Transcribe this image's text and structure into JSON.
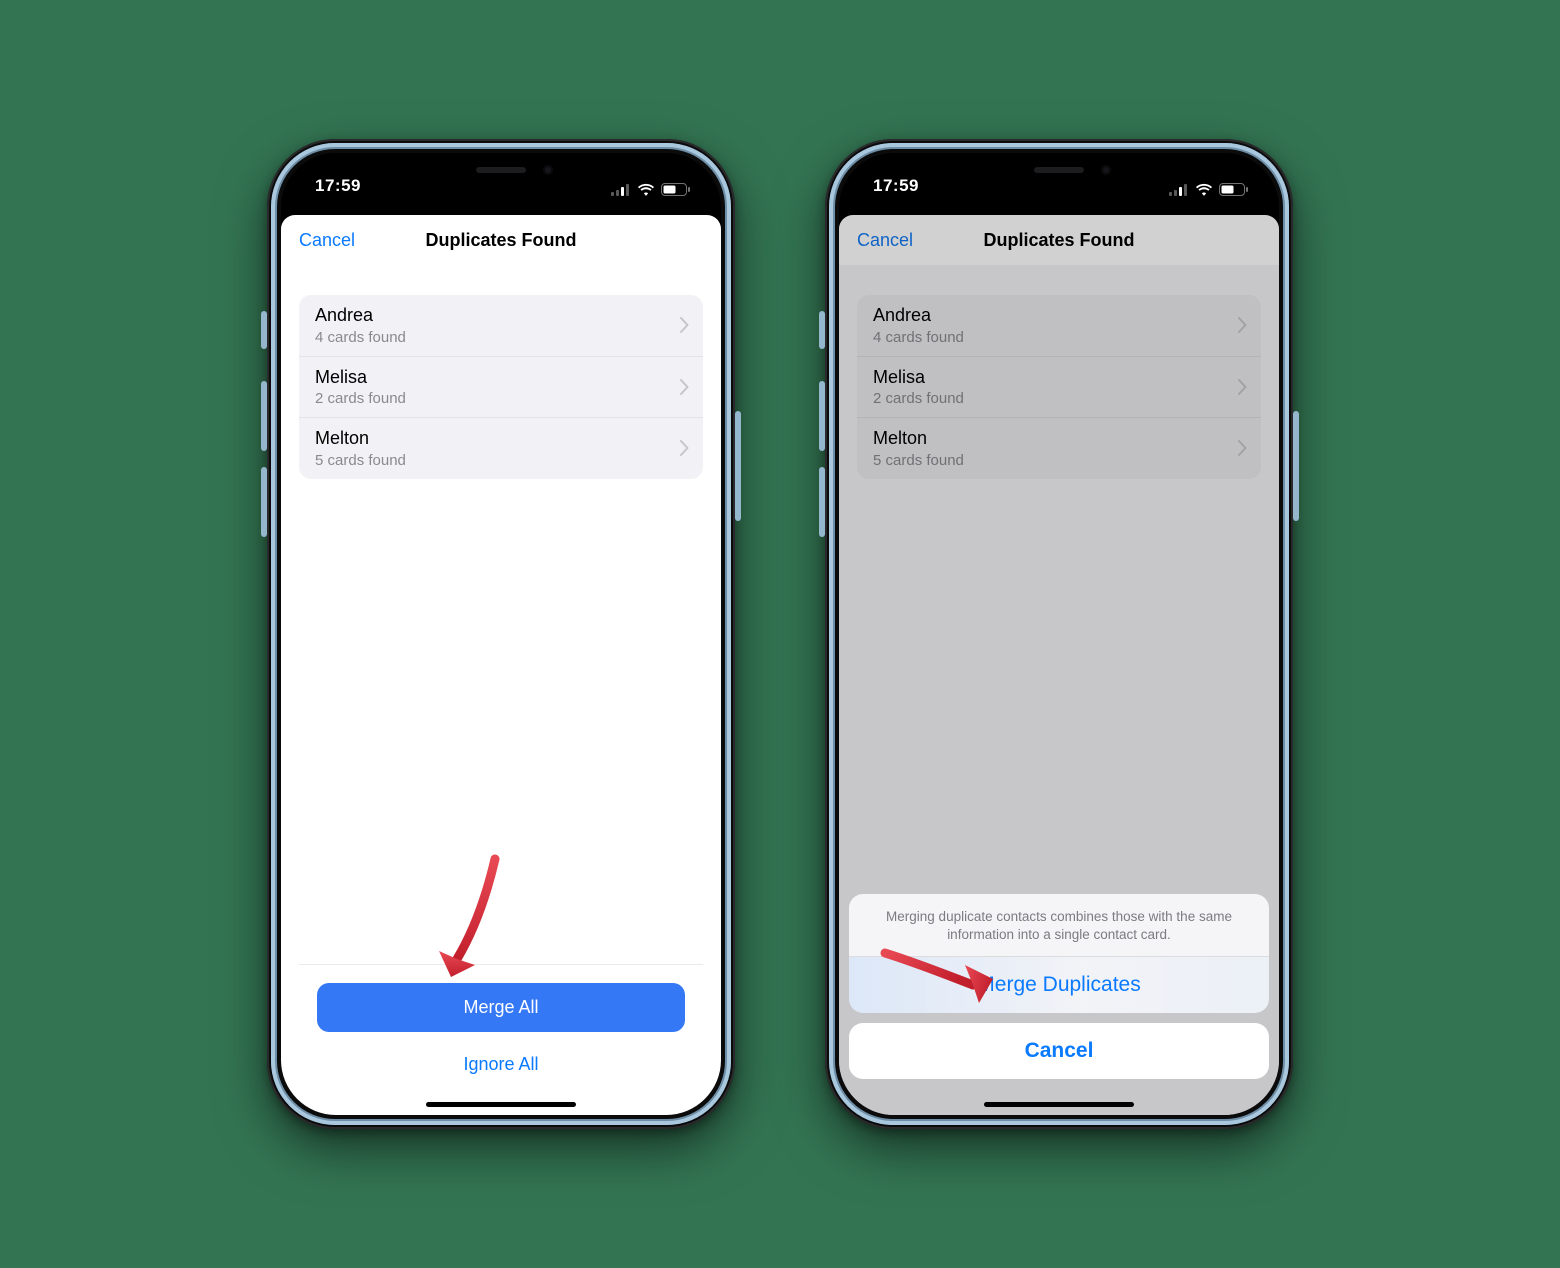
{
  "statusbar": {
    "time": "17:59"
  },
  "nav": {
    "cancel": "Cancel",
    "title": "Duplicates Found"
  },
  "duplicates": [
    {
      "name": "Andrea",
      "sub": "4 cards found"
    },
    {
      "name": "Melisa",
      "sub": "2 cards found"
    },
    {
      "name": "Melton",
      "sub": "5 cards found"
    }
  ],
  "footer": {
    "merge_all": "Merge All",
    "ignore_all": "Ignore All"
  },
  "actionsheet": {
    "message": "Merging duplicate contacts combines those with the same information into a single contact card.",
    "merge": "Merge Duplicates",
    "cancel": "Cancel"
  },
  "colors": {
    "accent": "#0a7aff",
    "primary_button": "#3478f6",
    "bg": "#337553",
    "arrow": "#d22f3a"
  }
}
